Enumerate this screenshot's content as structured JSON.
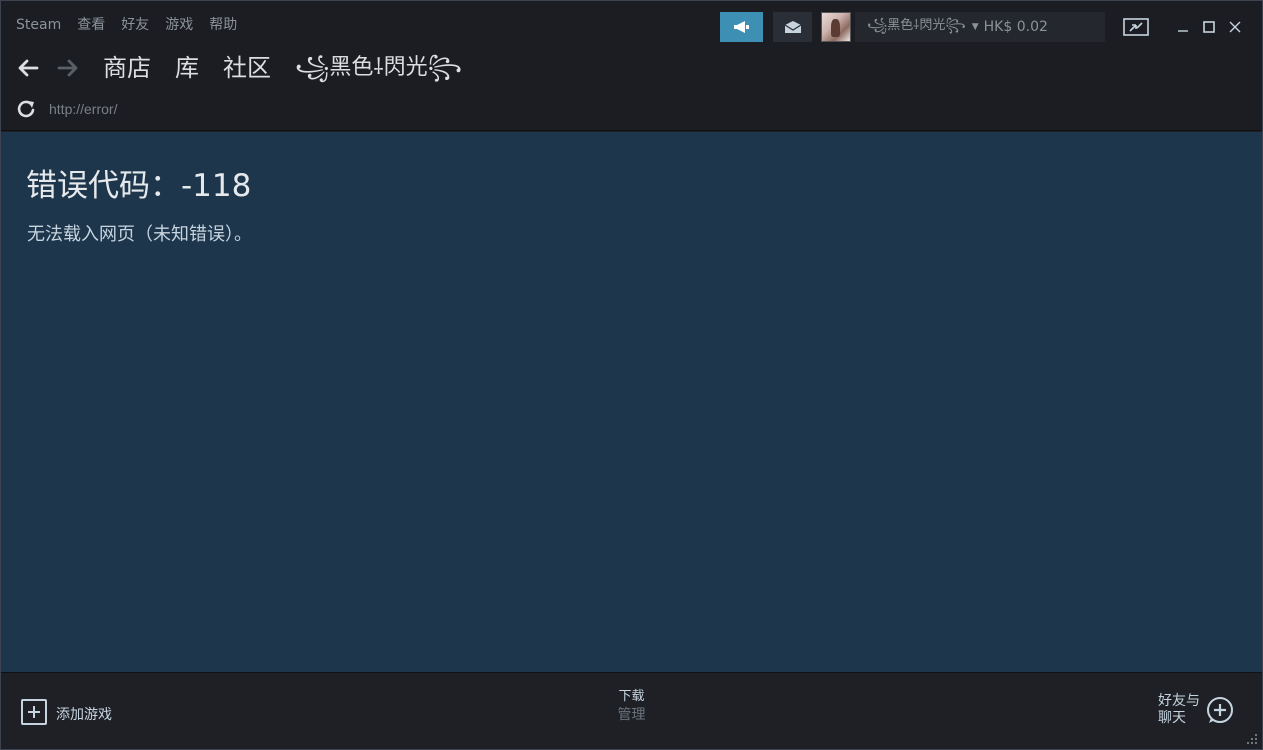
{
  "menu": [
    "Steam",
    "查看",
    "好友",
    "游戏",
    "帮助"
  ],
  "account": {
    "name": "꧁黑色⸸閃光꧂",
    "wallet": "HK$ 0.02"
  },
  "nav": {
    "store": "商店",
    "library": "库",
    "community": "社区",
    "username": "꧁黑色⸸閃光꧂"
  },
  "url": "http://error/",
  "error": {
    "title": "错误代码：-118",
    "message": "无法载入网页（未知错误）。"
  },
  "bottom": {
    "add_game": "添加游戏",
    "downloads": "下载",
    "manage": "管理",
    "friends_line1": "好友与",
    "friends_line2": "聊天"
  },
  "colors": {
    "accent": "#3d8fb4",
    "content_bg": "#1d364c",
    "chrome_bg": "#1b1d23"
  },
  "icons": [
    "announcement-icon",
    "envelope-icon",
    "back-arrow-icon",
    "forward-arrow-icon",
    "reload-icon",
    "big-picture-icon",
    "minimize-icon",
    "maximize-icon",
    "close-icon",
    "plus-icon",
    "chat-plus-icon"
  ]
}
